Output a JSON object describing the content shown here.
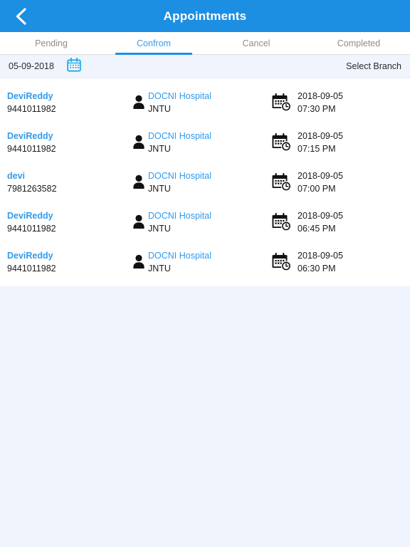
{
  "header": {
    "title": "Appointments",
    "back_icon": "chevron-left-icon",
    "bar_color": "#1d8fe3"
  },
  "tabs": [
    {
      "label": "Pending",
      "active": false
    },
    {
      "label": "Confrom",
      "active": true
    },
    {
      "label": "Cancel",
      "active": false
    },
    {
      "label": "Completed",
      "active": false
    }
  ],
  "filter": {
    "date": "05-09-2018",
    "calendar_icon": "calendar-icon",
    "select_branch_label": "Select Branch",
    "accent_color": "#29abe2"
  },
  "appointments": [
    {
      "patient_name": "DeviReddy",
      "patient_phone": "9441011982",
      "person_icon": "person-icon",
      "hospital": "DOCNI Hospital",
      "branch": "JNTU",
      "datetime_icon": "calendar-clock-icon",
      "date": "2018-09-05",
      "time": "07:30 PM"
    },
    {
      "patient_name": "DeviReddy",
      "patient_phone": "9441011982",
      "person_icon": "person-icon",
      "hospital": "DOCNI Hospital",
      "branch": "JNTU",
      "datetime_icon": "calendar-clock-icon",
      "date": "2018-09-05",
      "time": "07:15 PM"
    },
    {
      "patient_name": "devi",
      "patient_phone": "7981263582",
      "person_icon": "person-icon",
      "hospital": "DOCNI Hospital",
      "branch": "JNTU",
      "datetime_icon": "calendar-clock-icon",
      "date": "2018-09-05",
      "time": "07:00 PM"
    },
    {
      "patient_name": "DeviReddy",
      "patient_phone": "9441011982",
      "person_icon": "person-icon",
      "hospital": "DOCNI Hospital",
      "branch": "JNTU",
      "datetime_icon": "calendar-clock-icon",
      "date": "2018-09-05",
      "time": "06:45 PM"
    },
    {
      "patient_name": "DeviReddy",
      "patient_phone": "9441011982",
      "person_icon": "person-icon",
      "hospital": "DOCNI Hospital",
      "branch": "JNTU",
      "datetime_icon": "calendar-clock-icon",
      "date": "2018-09-05",
      "time": "06:30 PM"
    }
  ]
}
